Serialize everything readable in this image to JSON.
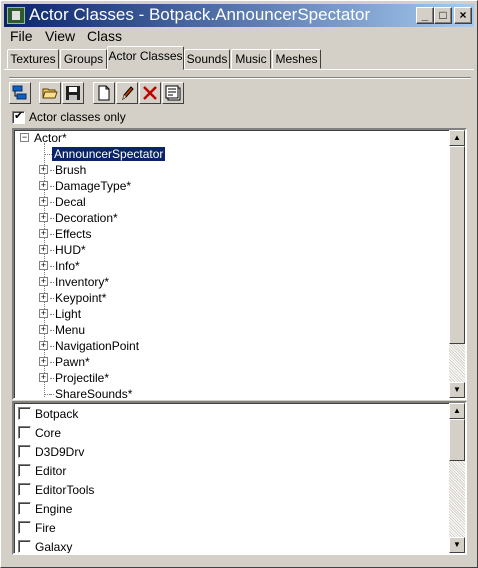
{
  "window": {
    "title": "Actor Classes - Botpack.AnnouncerSpectator",
    "minimize": "_",
    "maximize": "□",
    "close": "×"
  },
  "menu": {
    "file": "File",
    "view": "View",
    "class": "Class"
  },
  "tabs": [
    {
      "label": "Textures"
    },
    {
      "label": "Groups"
    },
    {
      "label": "Actor Classes",
      "active": true
    },
    {
      "label": "Sounds"
    },
    {
      "label": "Music"
    },
    {
      "label": "Meshes"
    }
  ],
  "toolbar": {
    "icons": [
      "tree-view-icon",
      "open-folder-icon",
      "save-icon",
      "new-document-icon",
      "edit-pencil-icon",
      "delete-x-icon",
      "properties-icon"
    ]
  },
  "filter": {
    "label": "Actor classes only",
    "checked": true
  },
  "tree": {
    "root": "Actor*",
    "selected": "AnnouncerSpectator",
    "children": [
      {
        "label": "Brush"
      },
      {
        "label": "DamageType*"
      },
      {
        "label": "Decal"
      },
      {
        "label": "Decoration*"
      },
      {
        "label": "Effects"
      },
      {
        "label": "HUD*"
      },
      {
        "label": "Info*"
      },
      {
        "label": "Inventory*"
      },
      {
        "label": "Keypoint*"
      },
      {
        "label": "Light"
      },
      {
        "label": "Menu"
      },
      {
        "label": "NavigationPoint"
      },
      {
        "label": "Pawn*"
      },
      {
        "label": "Projectile*"
      },
      {
        "label": "ShareSounds*"
      }
    ]
  },
  "packages": [
    {
      "label": "Botpack",
      "checked": false
    },
    {
      "label": "Core",
      "checked": false
    },
    {
      "label": "D3D9Drv",
      "checked": false
    },
    {
      "label": "Editor",
      "checked": false
    },
    {
      "label": "EditorTools",
      "checked": false
    },
    {
      "label": "Engine",
      "checked": false
    },
    {
      "label": "Fire",
      "checked": false
    },
    {
      "label": "Galaxy",
      "checked": false
    }
  ],
  "colors": {
    "titlebar_start": "#0a246a",
    "titlebar_end": "#a6caf0",
    "selection": "#0a246a",
    "face": "#d4d0c8"
  }
}
